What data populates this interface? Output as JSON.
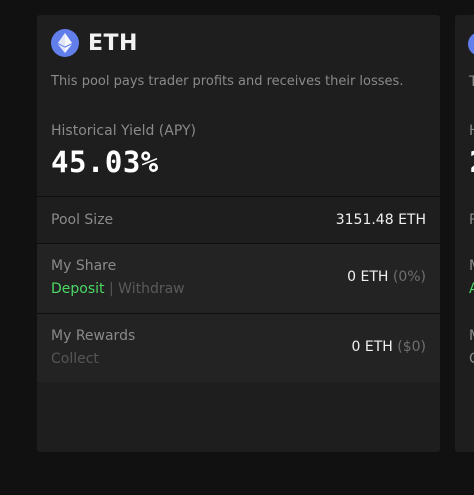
{
  "pool": {
    "title": "ETH",
    "icon": "ethereum-icon",
    "description": "This pool pays trader profits and receives their losses.",
    "yield_label": "Historical Yield (APY)",
    "yield_value": "45.03%",
    "pool_size_label": "Pool Size",
    "pool_size_value": "3151.48 ETH",
    "share_label": "My Share",
    "share_amount": "0 ETH",
    "share_percent": "(0%)",
    "deposit_label": "Deposit",
    "separator": "|",
    "withdraw_label": "Withdraw",
    "rewards_label": "My Rewards",
    "rewards_amount": "0 ETH",
    "rewards_usd": "($0)",
    "collect_label": "Collect"
  },
  "colors": {
    "background": "#111111",
    "card": "#1e1e1e",
    "accent_green": "#4cd964",
    "eth_blue": "#627eea"
  },
  "partial_card": {
    "desc_initial": "T",
    "yield_label_initial": "H",
    "yield_value_initial": "2",
    "pool_size_initial": "P",
    "share_initial": "M",
    "deposit_initial": "A",
    "rewards_initial": "M",
    "collect_initial": "C"
  }
}
